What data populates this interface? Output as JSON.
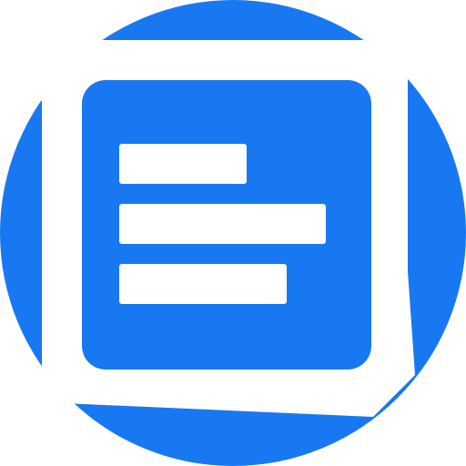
{
  "app_icon": {
    "icon": "document-lines-icon",
    "colors": {
      "primary": "#1878f2",
      "foreground": "#ffffff"
    }
  }
}
